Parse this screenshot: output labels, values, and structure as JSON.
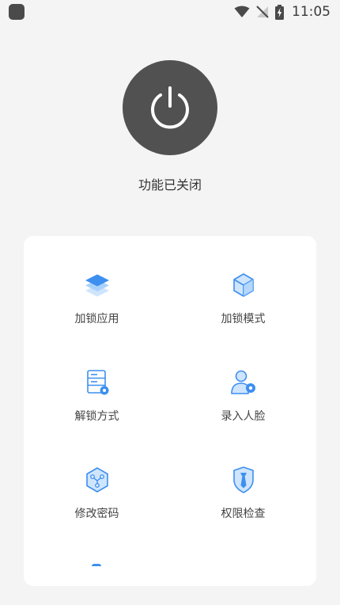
{
  "status": {
    "time": "11:05"
  },
  "power": {
    "label": "功能已关闭"
  },
  "menu": {
    "items": [
      {
        "label": "加锁应用",
        "icon": "layers-icon"
      },
      {
        "label": "加锁模式",
        "icon": "cube-icon"
      },
      {
        "label": "解锁方式",
        "icon": "server-settings-icon"
      },
      {
        "label": "录入人脸",
        "icon": "user-settings-icon"
      },
      {
        "label": "修改密码",
        "icon": "key-cube-icon"
      },
      {
        "label": "权限检查",
        "icon": "shield-tie-icon"
      }
    ]
  },
  "colors": {
    "accent": "#3d8ff0",
    "accent_light": "#a9d2fb",
    "power_bg": "#515151"
  }
}
